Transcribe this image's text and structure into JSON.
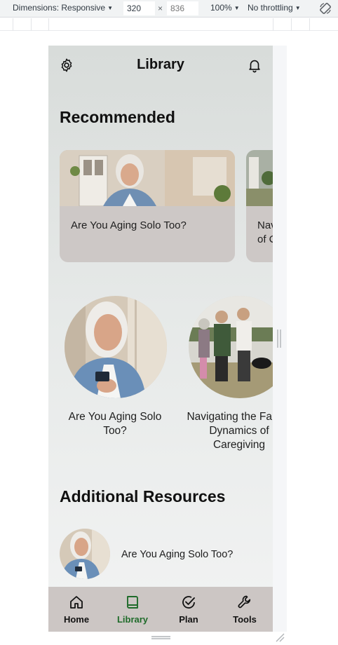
{
  "devtools": {
    "dimensions_label": "Dimensions: Responsive",
    "width_value": "320",
    "height_value": "836",
    "times_symbol": "×",
    "zoom": "100%",
    "throttling": "No throttling"
  },
  "app": {
    "title": "Library",
    "recommended_heading": "Recommended",
    "recommended_cards": [
      {
        "label": "Are You Aging Solo Too?"
      },
      {
        "label": "Navigating the Family Dynamics of Caregiving"
      }
    ],
    "circle_items": [
      {
        "caption": "Are You Aging Solo Too?"
      },
      {
        "caption": "Navigating the Family Dynamics of Caregiving"
      }
    ],
    "additional_heading": "Additional Resources",
    "resources": [
      {
        "label": "Are You Aging Solo Too?"
      }
    ],
    "nav": [
      {
        "label": "Home",
        "icon": "home-icon"
      },
      {
        "label": "Library",
        "icon": "book-icon",
        "active": true
      },
      {
        "label": "Plan",
        "icon": "check-circle-icon"
      },
      {
        "label": "Tools",
        "icon": "wrench-icon"
      }
    ],
    "colors": {
      "active_nav": "#1f6b2a",
      "nav_background": "#ccc6c4",
      "card_background": "#cdc8c6"
    }
  }
}
